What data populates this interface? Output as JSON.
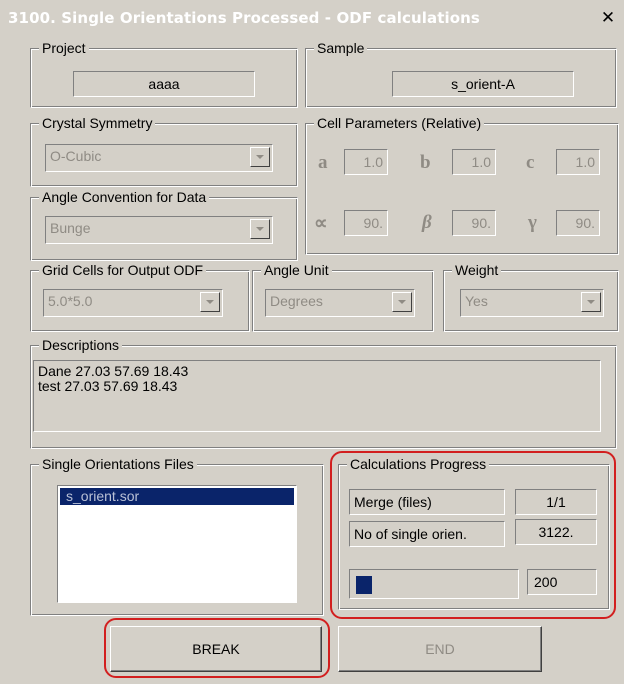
{
  "window": {
    "title": "3100. Single Orientations Processed - ODF calculations",
    "close_glyph": "✕",
    "title_bg": "#d4d0c8",
    "face_color": "#d4d0c8"
  },
  "project": {
    "legend": "Project",
    "value": "aaaa"
  },
  "sample": {
    "legend": "Sample",
    "value": "s_orient-A"
  },
  "crystal_symmetry": {
    "legend": "Crystal Symmetry",
    "value": "O-Cubic"
  },
  "angle_convention": {
    "legend": "Angle Convention for Data",
    "value": "Bunge"
  },
  "cell_parameters": {
    "legend": "Cell Parameters (Relative)",
    "a": {
      "label": "a",
      "value": "1.0"
    },
    "b": {
      "label": "b",
      "value": "1.0"
    },
    "c": {
      "label": "c",
      "value": "1.0"
    },
    "alpha": {
      "label": "∝",
      "value": "90."
    },
    "beta": {
      "label": "β",
      "value": "90."
    },
    "gamma": {
      "label": "γ",
      "value": "90."
    }
  },
  "grid_cells": {
    "legend": "Grid Cells for Output ODF",
    "value": "5.0*5.0"
  },
  "angle_unit": {
    "legend": "Angle Unit",
    "value": "Degrees"
  },
  "weight": {
    "legend": "Weight",
    "value": "Yes"
  },
  "descriptions": {
    "legend": "Descriptions",
    "lines": [
      "Dane 27.03 57.69 18.43",
      "test  27.03 57.69 18.43"
    ]
  },
  "files": {
    "legend": "Single Orientations Files",
    "items": [
      "s_orient.sor"
    ]
  },
  "progress": {
    "legend": "Calculations Progress",
    "merge_label": "Merge (files)",
    "merge_value": "1/1",
    "count_label": "No of single orien.",
    "count_value": "3122.",
    "progress_value": "200",
    "progress_fraction": 0.1
  },
  "buttons": {
    "break_label": "BREAK",
    "end_label": "END"
  },
  "annotation_color": "#d21f1f"
}
